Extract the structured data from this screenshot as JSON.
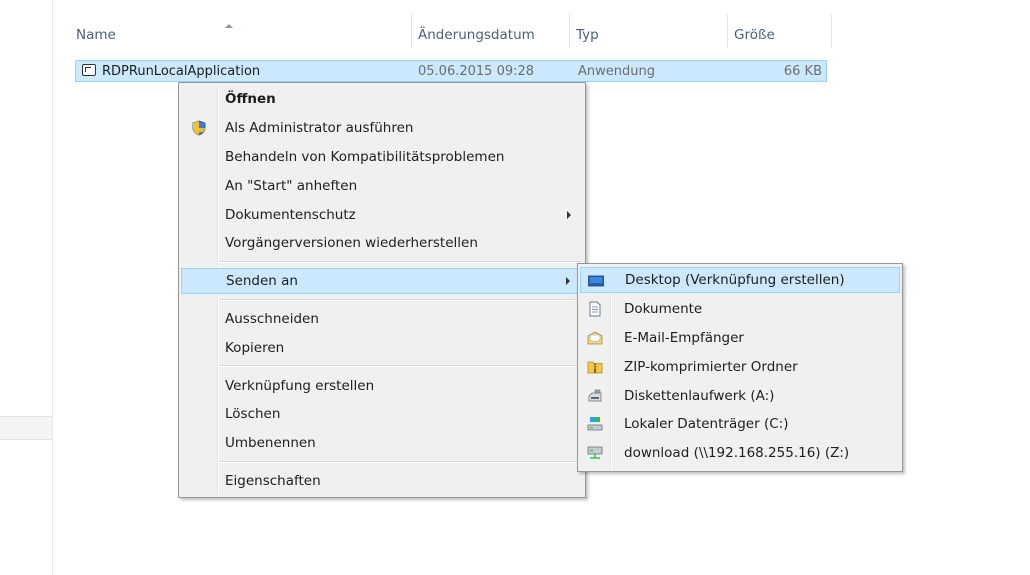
{
  "columns": {
    "name": "Name",
    "date": "Änderungsdatum",
    "type": "Typ",
    "size": "Größe"
  },
  "file": {
    "name": "RDPRunLocalApplication",
    "date": "05.06.2015 09:28",
    "type": "Anwendung",
    "size": "66 KB"
  },
  "context_menu": {
    "open": "Öffnen",
    "run_as_admin": "Als Administrator ausführen",
    "troubleshoot_compat": "Behandeln von Kompatibilitätsproblemen",
    "pin_to_start": "An \"Start\" anheften",
    "document_protection": "Dokumentenschutz",
    "restore_previous": "Vorgängerversionen wiederherstellen",
    "send_to": "Senden an",
    "cut": "Ausschneiden",
    "copy": "Kopieren",
    "create_shortcut": "Verknüpfung erstellen",
    "delete": "Löschen",
    "rename": "Umbenennen",
    "properties": "Eigenschaften"
  },
  "send_to_menu": {
    "desktop": "Desktop (Verknüpfung erstellen)",
    "documents": "Dokumente",
    "mail_recipient": "E-Mail-Empfänger",
    "zip_folder": "ZIP-komprimierter Ordner",
    "floppy": "Diskettenlaufwerk (A:)",
    "local_disk": "Lokaler Datenträger (C:)",
    "network_drive": "download (\\\\192.168.255.16) (Z:)"
  }
}
